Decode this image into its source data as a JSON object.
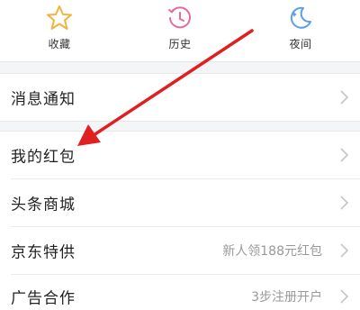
{
  "top_items": [
    {
      "label": "收藏",
      "icon": "star-icon",
      "color": "#f0b43c"
    },
    {
      "label": "历史",
      "icon": "history-clock-icon",
      "color": "#e66aa0"
    },
    {
      "label": "夜间",
      "icon": "moon-icon",
      "color": "#5aa0e6"
    }
  ],
  "menu": {
    "notifications": {
      "label": "消息通知"
    },
    "red_packet": {
      "label": "我的红包"
    },
    "mall": {
      "label": "头条商城"
    },
    "jd": {
      "label": "京东特供",
      "extra": "新人领188元红包"
    },
    "ads": {
      "label": "广告合作",
      "extra": "3步注册开户"
    }
  },
  "annotation": {
    "arrow_color": "#e02020"
  }
}
